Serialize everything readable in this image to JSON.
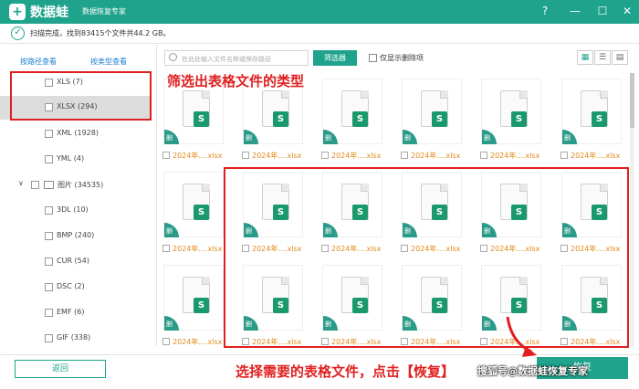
{
  "app": {
    "logo_glyph": "+",
    "name": "数据蛙",
    "subtitle": "数据恢复专家"
  },
  "window": {
    "help": "?",
    "minimize": "—",
    "maximize": "☐",
    "close": "✕"
  },
  "status": {
    "text": "扫描完成，找到83415个文件共44.2 GB。"
  },
  "sidebar": {
    "tab_path": "按路径查看",
    "tab_type": "按类型查看",
    "items": [
      {
        "label": "XLS (7)"
      },
      {
        "label": "XLSX (294)"
      },
      {
        "label": "XML (1928)"
      },
      {
        "label": "YML (4)"
      },
      {
        "label": "图片 (34535)"
      },
      {
        "label": "3DL (10)"
      },
      {
        "label": "BMP (240)"
      },
      {
        "label": "CUR (54)"
      },
      {
        "label": "DSC (2)"
      },
      {
        "label": "EMF (6)"
      },
      {
        "label": "GIF (338)"
      }
    ]
  },
  "toolbar": {
    "search_placeholder": "在此处输入文件名称或保存路径",
    "filter_label": "筛选器",
    "deleted_only_label": "仅显示删除项"
  },
  "file": {
    "name": "2024年....xlsx",
    "icon_letter": "S",
    "deleted_tag": "删"
  },
  "annotations": {
    "filter_note": "筛选出表格文件的类型",
    "select_note": "选择需要的表格文件，点击【恢复】"
  },
  "footer": {
    "back_label": "返回",
    "recover_label": "恢复",
    "watermark": "搜狐号@数据蛙恢复专家"
  },
  "colors": {
    "brand": "#1fa38c",
    "annotation": "#e02020",
    "file_name": "#e08a1b"
  }
}
